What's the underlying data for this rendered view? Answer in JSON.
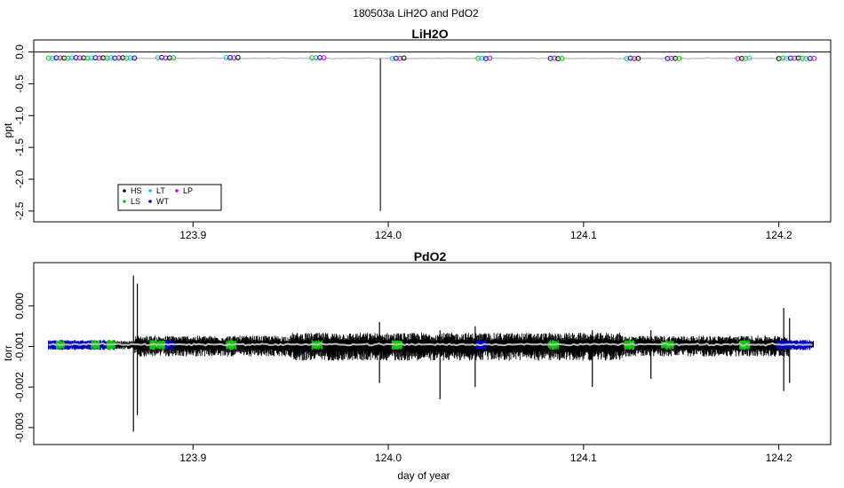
{
  "figure": {
    "suptitle": "180503a   LiH2O and PdO2",
    "colors": {
      "HS": "#000000",
      "LS": "#00cc00",
      "LT": "#00bfff",
      "WT": "#0000cc",
      "LP": "#cc00cc",
      "smooth": "#bebebe",
      "trace": "#000000",
      "refline": "#000000"
    }
  },
  "chart_data": [
    {
      "type": "scatter",
      "title": "LiH2O",
      "xlabel": "",
      "ylabel": "ppt",
      "xlim": [
        123.823,
        124.222
      ],
      "ylim": [
        -2.53,
        0.05
      ],
      "x_ticks": [
        "123.9",
        "124.0",
        "124.1",
        "124.2"
      ],
      "x_tick_values": [
        123.9,
        124.0,
        124.1,
        124.2
      ],
      "y_ticks": [
        "0.0",
        "-0.5",
        "-1.0",
        "-1.5",
        "-2.0",
        "-2.5"
      ],
      "y_tick_values": [
        0.0,
        -0.5,
        -1.0,
        -1.5,
        -2.0,
        -2.5
      ],
      "reference_line": 0.0,
      "baseline": -0.1,
      "spike": {
        "x": 123.996,
        "min": -2.5
      },
      "legend": {
        "placement": "bottom-left",
        "entries": [
          {
            "label": "HS",
            "color": "#000000"
          },
          {
            "label": "LT",
            "color": "#00bfff"
          },
          {
            "label": "LP",
            "color": "#cc00cc"
          },
          {
            "label": "LS",
            "color": "#00cc00"
          },
          {
            "label": "WT",
            "color": "#0000cc"
          }
        ]
      },
      "clusters": [
        {
          "x0": 123.826,
          "x1": 123.87,
          "y": -0.095
        },
        {
          "x0": 123.882,
          "x1": 123.89,
          "y": -0.09
        },
        {
          "x0": 123.917,
          "x1": 123.923,
          "y": -0.09
        },
        {
          "x0": 123.961,
          "x1": 123.967,
          "y": -0.09
        },
        {
          "x0": 124.002,
          "x1": 124.008,
          "y": -0.1
        },
        {
          "x0": 124.046,
          "x1": 124.052,
          "y": -0.1
        },
        {
          "x0": 124.083,
          "x1": 124.089,
          "y": -0.1
        },
        {
          "x0": 124.122,
          "x1": 124.128,
          "y": -0.1
        },
        {
          "x0": 124.143,
          "x1": 124.149,
          "y": -0.1
        },
        {
          "x0": 124.179,
          "x1": 124.185,
          "y": -0.1
        },
        {
          "x0": 124.2,
          "x1": 124.218,
          "y": -0.1
        }
      ]
    },
    {
      "type": "line",
      "title": "PdO2",
      "xlabel": "day of year",
      "ylabel": "torr",
      "xlim": [
        123.823,
        124.222
      ],
      "ylim": [
        -0.0032,
        0.00085
      ],
      "x_ticks": [
        "123.9",
        "124.0",
        "124.1",
        "124.2"
      ],
      "x_tick_values": [
        123.9,
        124.0,
        124.1,
        124.2
      ],
      "y_ticks": [
        "0.000",
        "-0.001",
        "-0.002",
        "-0.003"
      ],
      "y_tick_values": [
        0.0,
        -0.001,
        -0.002,
        -0.003
      ],
      "baseline": -0.00095,
      "spikes": [
        {
          "x": 123.8695,
          "min": -0.0031,
          "max": 0.00075
        },
        {
          "x": 123.8715,
          "min": -0.0027,
          "max": 0.00055
        },
        {
          "x": 123.9955,
          "min": -0.0019,
          "max": -0.0004
        },
        {
          "x": 124.0265,
          "min": -0.0023,
          "max": -0.0006
        },
        {
          "x": 124.0445,
          "min": -0.002,
          "max": -0.0005
        },
        {
          "x": 124.1045,
          "min": -0.002,
          "max": -0.0006
        },
        {
          "x": 124.1345,
          "min": -0.0018,
          "max": -0.0006
        },
        {
          "x": 124.2025,
          "min": -0.0021,
          "max": -5e-05
        },
        {
          "x": 124.2055,
          "min": -0.0019,
          "max": -0.0003
        }
      ],
      "colored_segments": [
        {
          "x0": 123.826,
          "x1": 123.86,
          "color": "#0000cc"
        },
        {
          "x0": 123.83,
          "x1": 123.834,
          "color": "#00cc00"
        },
        {
          "x0": 123.848,
          "x1": 123.852,
          "color": "#00cc00"
        },
        {
          "x0": 123.856,
          "x1": 123.86,
          "color": "#00cc00"
        },
        {
          "x0": 123.878,
          "x1": 123.886,
          "color": "#00cc00"
        },
        {
          "x0": 123.886,
          "x1": 123.89,
          "color": "#0000cc"
        },
        {
          "x0": 123.917,
          "x1": 123.922,
          "color": "#00cc00"
        },
        {
          "x0": 123.961,
          "x1": 123.966,
          "color": "#00cc00"
        },
        {
          "x0": 124.002,
          "x1": 124.007,
          "color": "#00cc00"
        },
        {
          "x0": 124.045,
          "x1": 124.05,
          "color": "#0000cc"
        },
        {
          "x0": 124.082,
          "x1": 124.087,
          "color": "#00cc00"
        },
        {
          "x0": 124.121,
          "x1": 124.126,
          "color": "#00cc00"
        },
        {
          "x0": 124.14,
          "x1": 124.146,
          "color": "#00cc00"
        },
        {
          "x0": 124.18,
          "x1": 124.185,
          "color": "#00cc00"
        },
        {
          "x0": 124.199,
          "x1": 124.216,
          "color": "#0000cc"
        }
      ]
    }
  ]
}
